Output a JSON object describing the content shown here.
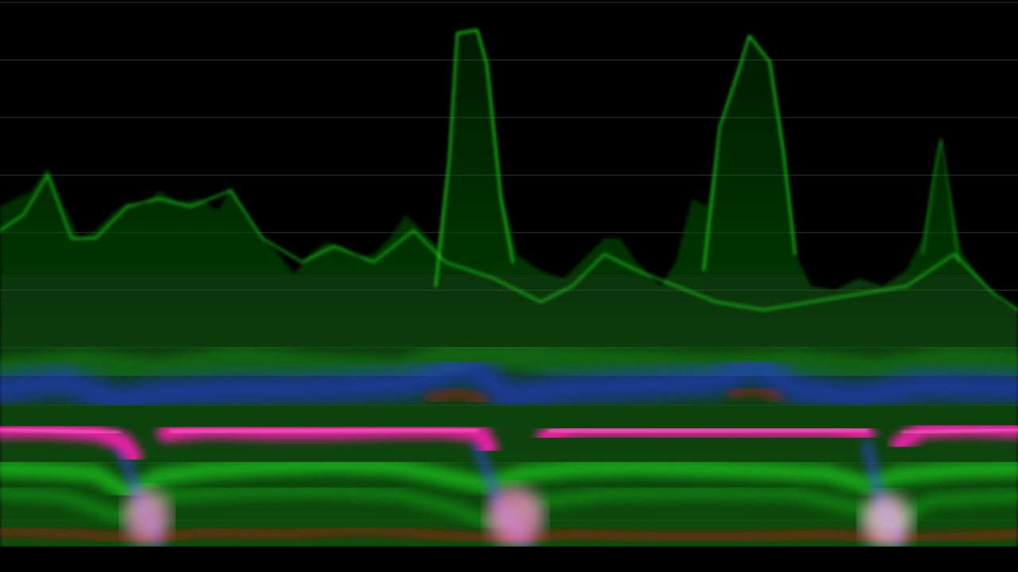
{
  "scope": {
    "type": "rgb-parade-waveform",
    "graticule_lines": 10,
    "colors": {
      "background": "#000000",
      "graticule": "#5a5a5a",
      "green": "#1fd11f",
      "magenta": "#ff2aa8",
      "blue": "#2a3cff",
      "red": "#d01010",
      "pink_core": "#ff9ad6"
    }
  }
}
